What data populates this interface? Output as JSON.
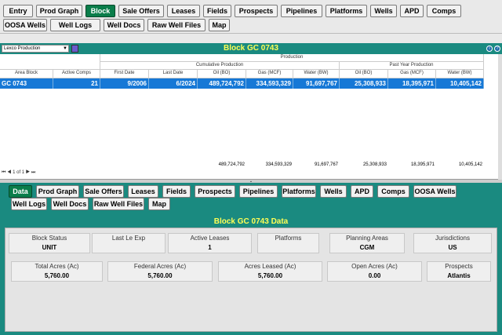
{
  "top_nav": {
    "row1": [
      "Entry",
      "Prod Graph",
      "Block",
      "Sale Offers",
      "Leases",
      "Fields",
      "Prospects",
      "Pipelines",
      "Platforms",
      "Wells",
      "APD",
      "Comps"
    ],
    "row2": [
      "OOSA Wells",
      "Well Logs",
      "Well Docs",
      "Raw Well Files",
      "Map"
    ],
    "active": "Block"
  },
  "grid": {
    "dropdown_value": "Lexco Production",
    "title": "Block GC 0743",
    "headers": {
      "group_production": "Production",
      "group_cumulative": "Cumulative Production",
      "group_past_year": "Past Year Production",
      "area_block": "Area Block",
      "active_comps": "Active Comps",
      "first_date": "First Date",
      "last_date": "Last Date",
      "oil_bo": "Oil (BO)",
      "gas_mcf": "Gas (MCF)",
      "water_bw": "Water (BW)",
      "py_oil_bo": "Oil (BO)",
      "py_gas_mcf": "Gas (MCF)",
      "py_water_bw": "Water (BW)"
    },
    "row": {
      "area_block": "GC 0743",
      "active_comps": "21",
      "first_date": "9/2006",
      "last_date": "6/2024",
      "oil_bo": "489,724,792",
      "gas_mcf": "334,593,329",
      "water_bw": "91,697,767",
      "py_oil_bo": "25,308,933",
      "py_gas_mcf": "18,395,971",
      "py_water_bw": "10,405,142"
    },
    "totals": {
      "oil_bo": "489,724,792",
      "gas_mcf": "334,593,329",
      "water_bw": "91,697,767",
      "py_oil_bo": "25,308,933",
      "py_gas_mcf": "18,395,971",
      "py_water_bw": "10,405,142"
    },
    "pager": "1 of 1"
  },
  "sub_nav": {
    "row1": [
      "Data",
      "Prod Graph",
      "Sale Offers",
      "Leases",
      "Fields",
      "Prospects",
      "Pipelines",
      "Platforms",
      "Wells",
      "APD",
      "Comps",
      "OOSA Wells"
    ],
    "row2": [
      "Well Logs",
      "Well Docs",
      "Raw Well Files",
      "Map"
    ],
    "active": "Data"
  },
  "data_section": {
    "title": "Block GC 0743 Data",
    "fields_row1": [
      {
        "label": "Block Status",
        "value": "UNIT"
      },
      {
        "label": "Last Le Exp",
        "value": ""
      },
      {
        "label": "Active Leases",
        "value": "1"
      },
      {
        "label": "Platforms",
        "value": ""
      },
      {
        "label": "Planning Areas",
        "value": "CGM"
      },
      {
        "label": "Jurisdictions",
        "value": "US"
      }
    ],
    "fields_row2": [
      {
        "label": "Total Acres (Ac)",
        "value": "5,760.00"
      },
      {
        "label": "Federal Acres (Ac)",
        "value": "5,760.00"
      },
      {
        "label": "Acres Leased (Ac)",
        "value": "5,760.00"
      },
      {
        "label": "Open Acres (Ac)",
        "value": "0.00"
      },
      {
        "label": "Prospects",
        "value": "Atlantis"
      }
    ]
  },
  "colors": {
    "accent_teal": "#1a8a80",
    "active_green": "#0a7d4a",
    "title_yellow": "#ffff55",
    "row_blue": "#1678d6"
  }
}
